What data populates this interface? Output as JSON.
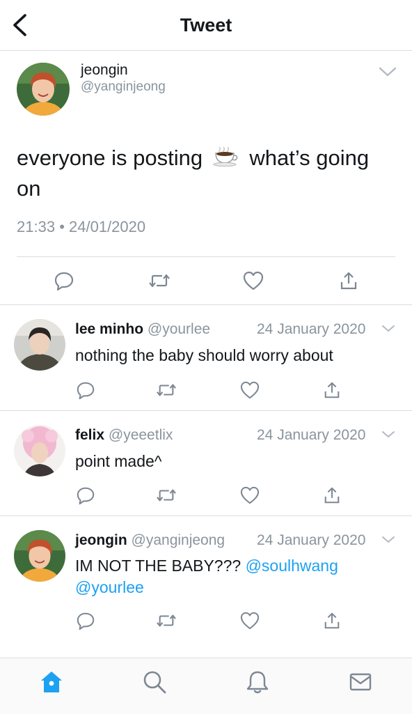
{
  "header": {
    "title": "Tweet"
  },
  "main_tweet": {
    "name": "jeongin",
    "handle": "@yanginjeong",
    "text_before": "everyone is posting",
    "emoji": "coffee-icon",
    "text_after": "what’s going on",
    "time": "21:33",
    "separator": "•",
    "date": "24/01/2020"
  },
  "replies": [
    {
      "name": "lee minho",
      "handle": "@yourlee",
      "date": "24 January 2020",
      "text": "nothing the baby should worry about"
    },
    {
      "name": "felix",
      "handle": "@yeeetlix",
      "date": "24 January 2020",
      "text": "point made^"
    },
    {
      "name": "jeongin",
      "handle": "@yanginjeong",
      "date": "24 January 2020",
      "text": "IM NOT THE BABY??? ",
      "mention_1": "@soulhwang",
      "mention_2": "@yourlee"
    }
  ],
  "tabbar": [
    "home-icon",
    "search-icon",
    "bell-icon",
    "mail-icon"
  ],
  "colors": {
    "accent": "#1da1f2",
    "muted": "#8a949e",
    "icon": "#7d8793",
    "divider": "#d9dde1"
  }
}
